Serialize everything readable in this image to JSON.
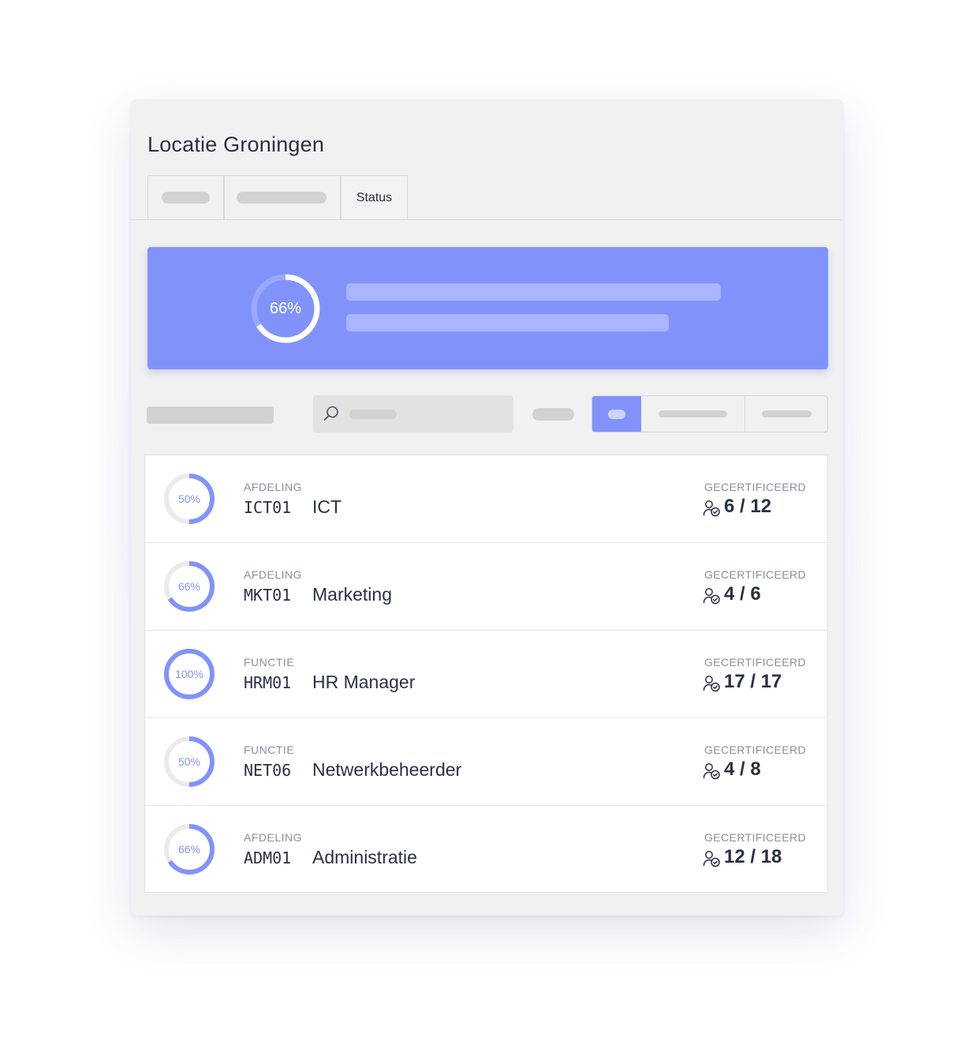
{
  "title": "Locatie Groningen",
  "tabs": {
    "active_label": "Status"
  },
  "summary": {
    "percent_label": "66%",
    "percent": 66
  },
  "colors": {
    "accent": "#8193fb",
    "track": "#ebebeb",
    "banner_track": "#9aa8fc"
  },
  "icons": {
    "search": "search-icon",
    "certified": "user-check-icon"
  },
  "rows": [
    {
      "kind": "AFDELING",
      "code": "ICT01",
      "name": "ICT",
      "percent_label": "50%",
      "percent": 50,
      "cert_label": "GECERTIFICEERD",
      "cert_value": "6 / 12"
    },
    {
      "kind": "AFDELING",
      "code": "MKT01",
      "name": "Marketing",
      "percent_label": "66%",
      "percent": 66,
      "cert_label": "GECERTIFICEERD",
      "cert_value": "4 / 6"
    },
    {
      "kind": "FUNCTIE",
      "code": "HRM01",
      "name": "HR Manager",
      "percent_label": "100%",
      "percent": 100,
      "cert_label": "GECERTIFICEERD",
      "cert_value": "17 / 17"
    },
    {
      "kind": "FUNCTIE",
      "code": "NET06",
      "name": "Netwerkbeheerder",
      "percent_label": "50%",
      "percent": 50,
      "cert_label": "GECERTIFICEERD",
      "cert_value": "4 / 8"
    },
    {
      "kind": "AFDELING",
      "code": "ADM01",
      "name": "Administratie",
      "percent_label": "66%",
      "percent": 66,
      "cert_label": "GECERTIFICEERD",
      "cert_value": "12 / 18"
    }
  ]
}
